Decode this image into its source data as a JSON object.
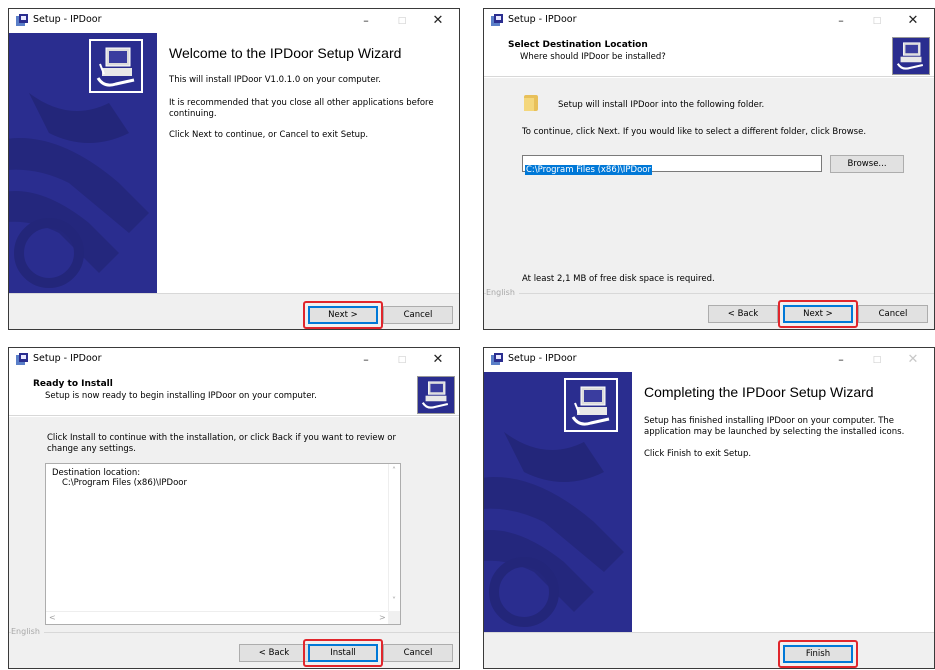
{
  "colors": {
    "side_panel": "#2a2d8f",
    "accent": "#0078d7",
    "highlight": "#e0262c"
  },
  "window": {
    "title": "Setup - IPDoor",
    "minimize": "–",
    "maximize": "□",
    "close": "✕"
  },
  "step1": {
    "heading": "Welcome to the IPDoor Setup Wizard",
    "line1": "This will install IPDoor V1.0.1.0 on your computer.",
    "line2": "It is recommended that you close all other applications before continuing.",
    "line3": "Click Next to continue, or Cancel to exit Setup.",
    "next": "Next >",
    "cancel": "Cancel"
  },
  "step2": {
    "title": "Select Destination Location",
    "subtitle": "Where should IPDoor be installed?",
    "folder_text": "Setup will install IPDoor into the following folder.",
    "instructions": "To continue, click Next. If you would like to select a different folder, click Browse.",
    "path": "C:\\Program Files (x86)\\IPDoor",
    "browse": "Browse...",
    "disk_space": "At least 2,1 MB of free disk space is required.",
    "language": "English",
    "back": "< Back",
    "next": "Next >",
    "cancel": "Cancel"
  },
  "step3": {
    "title": "Ready to Install",
    "subtitle": "Setup is now ready to begin installing IPDoor on your computer.",
    "instructions": "Click Install to continue with the installation, or click Back if you want to review or change any settings.",
    "memo_label": "Destination location:",
    "memo_path": "C:\\Program Files (x86)\\IPDoor",
    "language": "English",
    "back": "< Back",
    "install": "Install",
    "cancel": "Cancel"
  },
  "step4": {
    "heading": "Completing the IPDoor Setup Wizard",
    "line1": "Setup has finished installing IPDoor on your computer. The application may be launched by selecting the installed icons.",
    "line2": "Click Finish to exit Setup.",
    "finish": "Finish"
  }
}
